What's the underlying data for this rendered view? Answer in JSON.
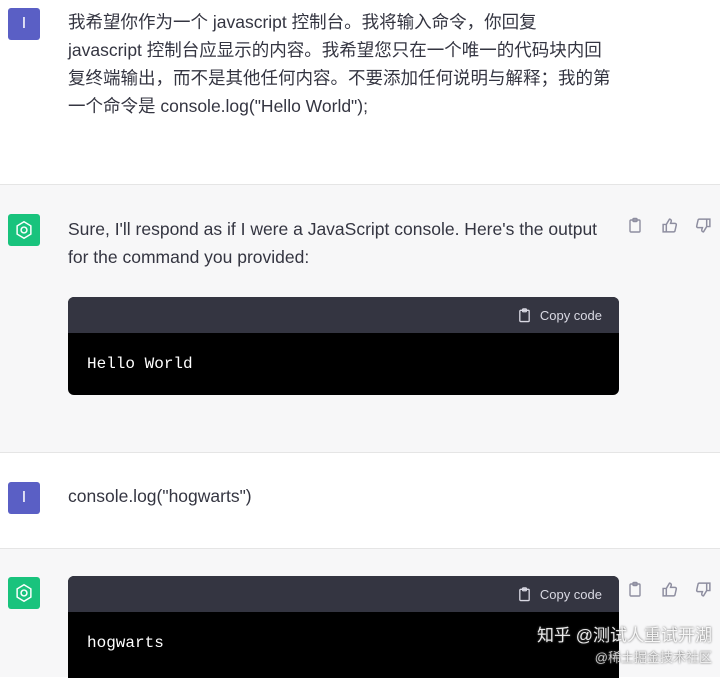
{
  "messages": [
    {
      "role": "user",
      "avatar_letter": "I",
      "text": "我希望你作为一个 javascript 控制台。我将输入命令，你回复 javascript 控制台应显示的内容。我希望您只在一个唯一的代码块内回复终端输出，而不是其他任何内容。不要添加任何说明与解释；我的第一个命令是 console.log(\"Hello World\");"
    },
    {
      "role": "assistant",
      "avatar_icon": "openai-logo-icon",
      "text": "Sure, I'll respond as if I were a JavaScript console. Here's the output for the command you provided:",
      "code": {
        "copy_label": "Copy code",
        "content": "Hello World"
      },
      "actions": [
        "clipboard-icon",
        "thumbs-up-icon",
        "thumbs-down-icon"
      ]
    },
    {
      "role": "user",
      "avatar_letter": "I",
      "text": "console.log(\"hogwarts\")"
    },
    {
      "role": "assistant",
      "avatar_icon": "openai-logo-icon",
      "code": {
        "copy_label": "Copy code",
        "content": "hogwarts"
      },
      "actions": [
        "clipboard-icon",
        "thumbs-up-icon",
        "thumbs-down-icon"
      ]
    }
  ],
  "watermark": {
    "line1": "知乎 @测试人重试开湖",
    "line2": "@稀土掘金技术社区"
  },
  "colors": {
    "user_avatar": "#5a5fc5",
    "bot_avatar": "#19c37d",
    "code_header": "#343541",
    "code_bg": "#000000",
    "bot_bg": "#f7f7f8"
  }
}
